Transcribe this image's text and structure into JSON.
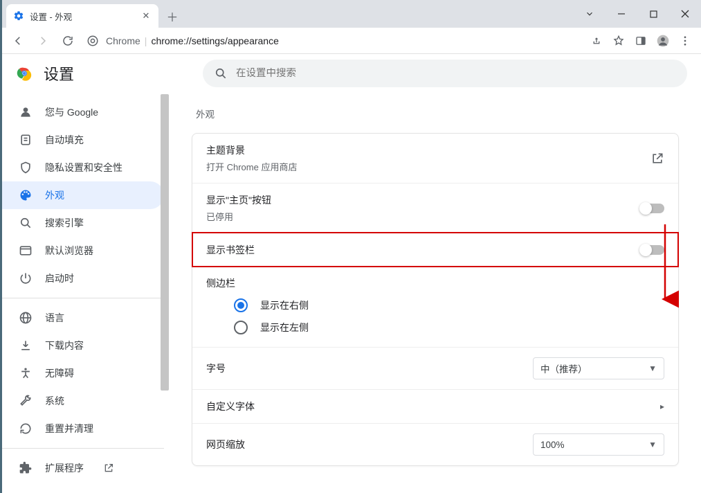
{
  "window": {
    "tab_title": "设置 - 外观"
  },
  "toolbar": {
    "chrome_label": "Chrome",
    "url": "chrome://settings/appearance"
  },
  "header": {
    "app_name": "设置",
    "search_placeholder": "在设置中搜索"
  },
  "sidebar": {
    "items": [
      {
        "icon": "person",
        "label": "您与 Google"
      },
      {
        "icon": "autofill",
        "label": "自动填充"
      },
      {
        "icon": "shield",
        "label": "隐私设置和安全性"
      },
      {
        "icon": "palette",
        "label": "外观"
      },
      {
        "icon": "search",
        "label": "搜索引擎"
      },
      {
        "icon": "browser",
        "label": "默认浏览器"
      },
      {
        "icon": "power",
        "label": "启动时"
      },
      {
        "icon": "globe",
        "label": "语言"
      },
      {
        "icon": "download",
        "label": "下载内容"
      },
      {
        "icon": "accessibility",
        "label": "无障碍"
      },
      {
        "icon": "wrench",
        "label": "系统"
      },
      {
        "icon": "reset",
        "label": "重置并清理"
      },
      {
        "icon": "extension",
        "label": "扩展程序"
      }
    ]
  },
  "main": {
    "section_title": "外观",
    "rows": {
      "theme": {
        "title": "主题背景",
        "subtitle": "打开 Chrome 应用商店"
      },
      "home_btn": {
        "title": "显示\"主页\"按钮",
        "subtitle": "已停用"
      },
      "bookmarks": {
        "title": "显示书签栏"
      },
      "sidepanel": {
        "title": "侧边栏",
        "opt_right": "显示在右侧",
        "opt_left": "显示在左侧"
      },
      "font_size": {
        "title": "字号",
        "value": "中（推荐）"
      },
      "custom_font": {
        "title": "自定义字体"
      },
      "zoom": {
        "title": "网页缩放",
        "value": "100%"
      }
    }
  }
}
